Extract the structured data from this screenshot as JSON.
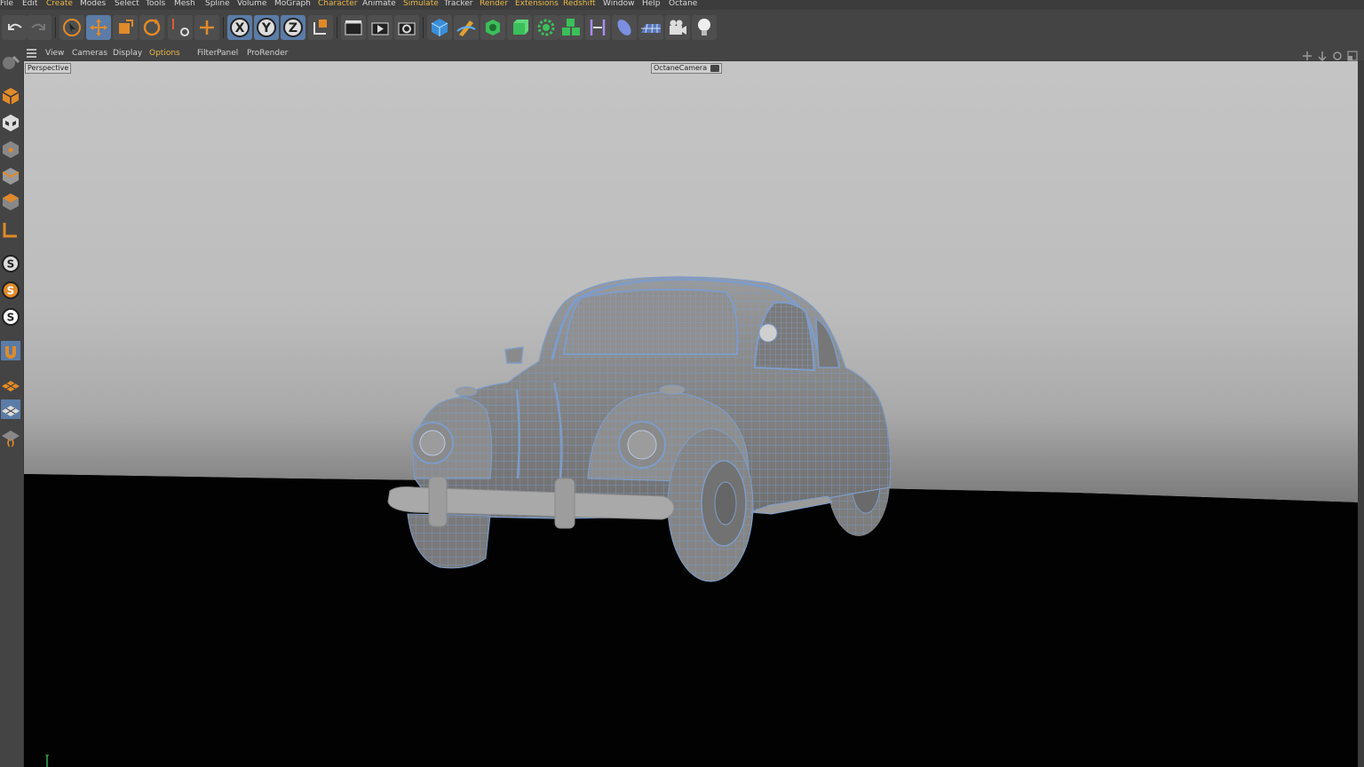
{
  "menu": [
    "File",
    "Edit",
    "Create",
    "Modes",
    "Select",
    "Tools",
    "Mesh",
    "Spline",
    "Volume",
    "MoGraph",
    "Character",
    "Animate",
    "Simulate",
    "Tracker",
    "Render",
    "Extensions",
    "Redshift",
    "Window",
    "Help",
    "Octane"
  ],
  "viewport_menu": [
    "View",
    "Cameras",
    "Display",
    "Options",
    "Filter",
    "Panel",
    "ProRender"
  ],
  "viewport": {
    "view_label": "Perspective",
    "camera_label": "OctaneCamera",
    "axis_label": "Y"
  },
  "toolbar": {
    "axis_x": "X",
    "axis_y": "Y",
    "axis_z": "Z"
  },
  "leftbar": {
    "snap_letter": "S"
  },
  "colors": {
    "accent_orange": "#e08a2a",
    "selected_blue": "#5b7ca6",
    "wireframe_blue": "#7e9cc8",
    "menu_highlight": "#e8b84a"
  }
}
